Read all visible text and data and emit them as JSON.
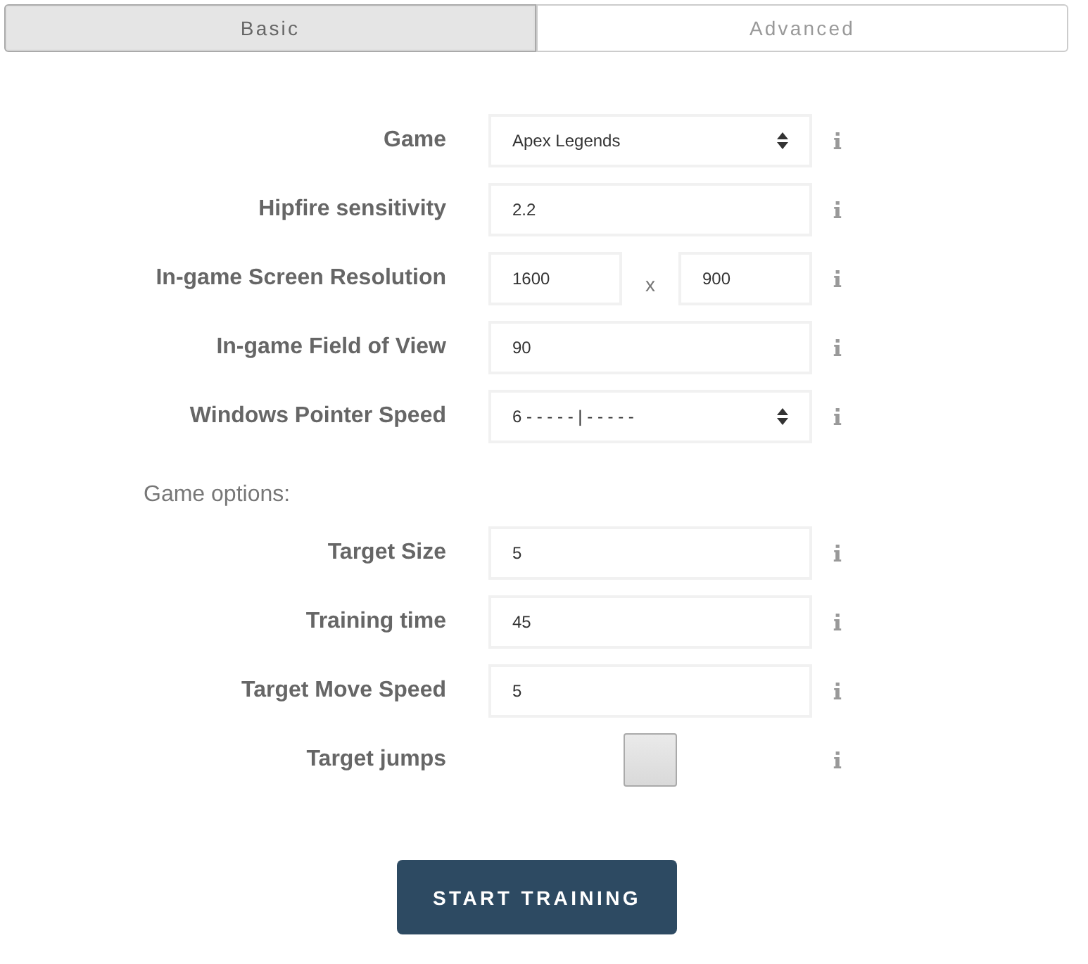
{
  "tabs": [
    {
      "label": "Basic",
      "selected": true
    },
    {
      "label": "Advanced",
      "selected": false
    }
  ],
  "settings": [
    {
      "kind": "select",
      "label": "Game",
      "value": "Apex Legends"
    },
    {
      "kind": "text",
      "label": "Hipfire sensitivity",
      "value": "2.2"
    },
    {
      "kind": "pair",
      "label": "In-game Screen Resolution",
      "first": "1600",
      "separator": "x",
      "second": "900"
    },
    {
      "kind": "text",
      "label": "In-game Field of View",
      "value": "90"
    },
    {
      "kind": "select",
      "label": "Windows Pointer Speed",
      "value": "6 - - - - - | - - - - -"
    }
  ],
  "options_heading": "Game options:",
  "options": [
    {
      "kind": "text",
      "label": "Target Size",
      "value": "5"
    },
    {
      "kind": "text",
      "label": "Training time",
      "value": "45"
    },
    {
      "kind": "text",
      "label": "Target Move Speed",
      "value": "5"
    },
    {
      "kind": "checkbox",
      "label": "Target jumps",
      "checked": false
    }
  ],
  "start_button": "START TRAINING"
}
